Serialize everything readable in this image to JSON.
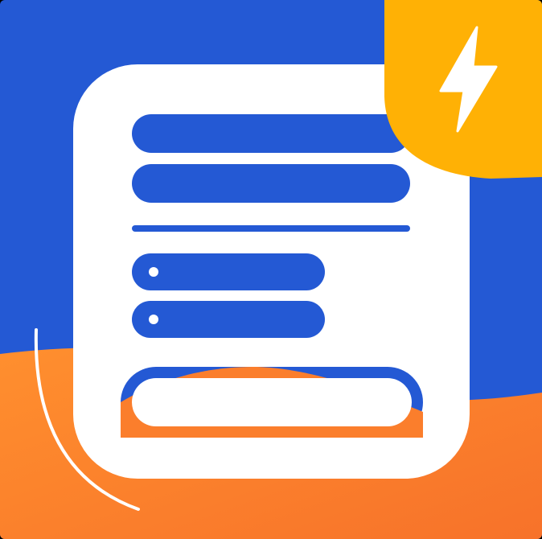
{
  "colors": {
    "blue": "#2459D4",
    "white": "#FFFFFF",
    "orange": "#FB7E2C",
    "orange_light": "#FF8F2E",
    "yellow": "#FFB105"
  },
  "icons": {
    "badge": "lightning-bolt-icon",
    "card": "form-card-icon"
  }
}
